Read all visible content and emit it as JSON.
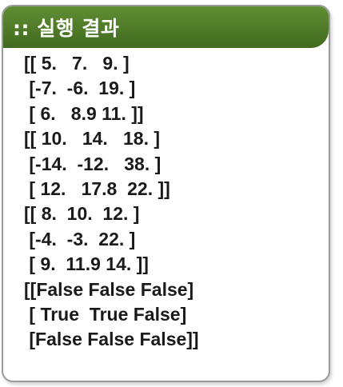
{
  "header": {
    "title": ":: 실행 결과"
  },
  "output": {
    "lines": [
      "[[ 5.   7.   9. ]",
      " [-7.  -6.  19. ]",
      " [ 6.   8.9 11. ]]",
      "[[ 10.   14.   18. ]",
      " [-14.  -12.   38. ]",
      " [ 12.   17.8  22. ]]",
      "[[ 8.  10.  12. ]",
      " [-4.  -3.  22. ]",
      " [ 9.  11.9 14. ]]",
      "[[False False False]",
      " [ True  True False]",
      " [False False False]]"
    ]
  }
}
